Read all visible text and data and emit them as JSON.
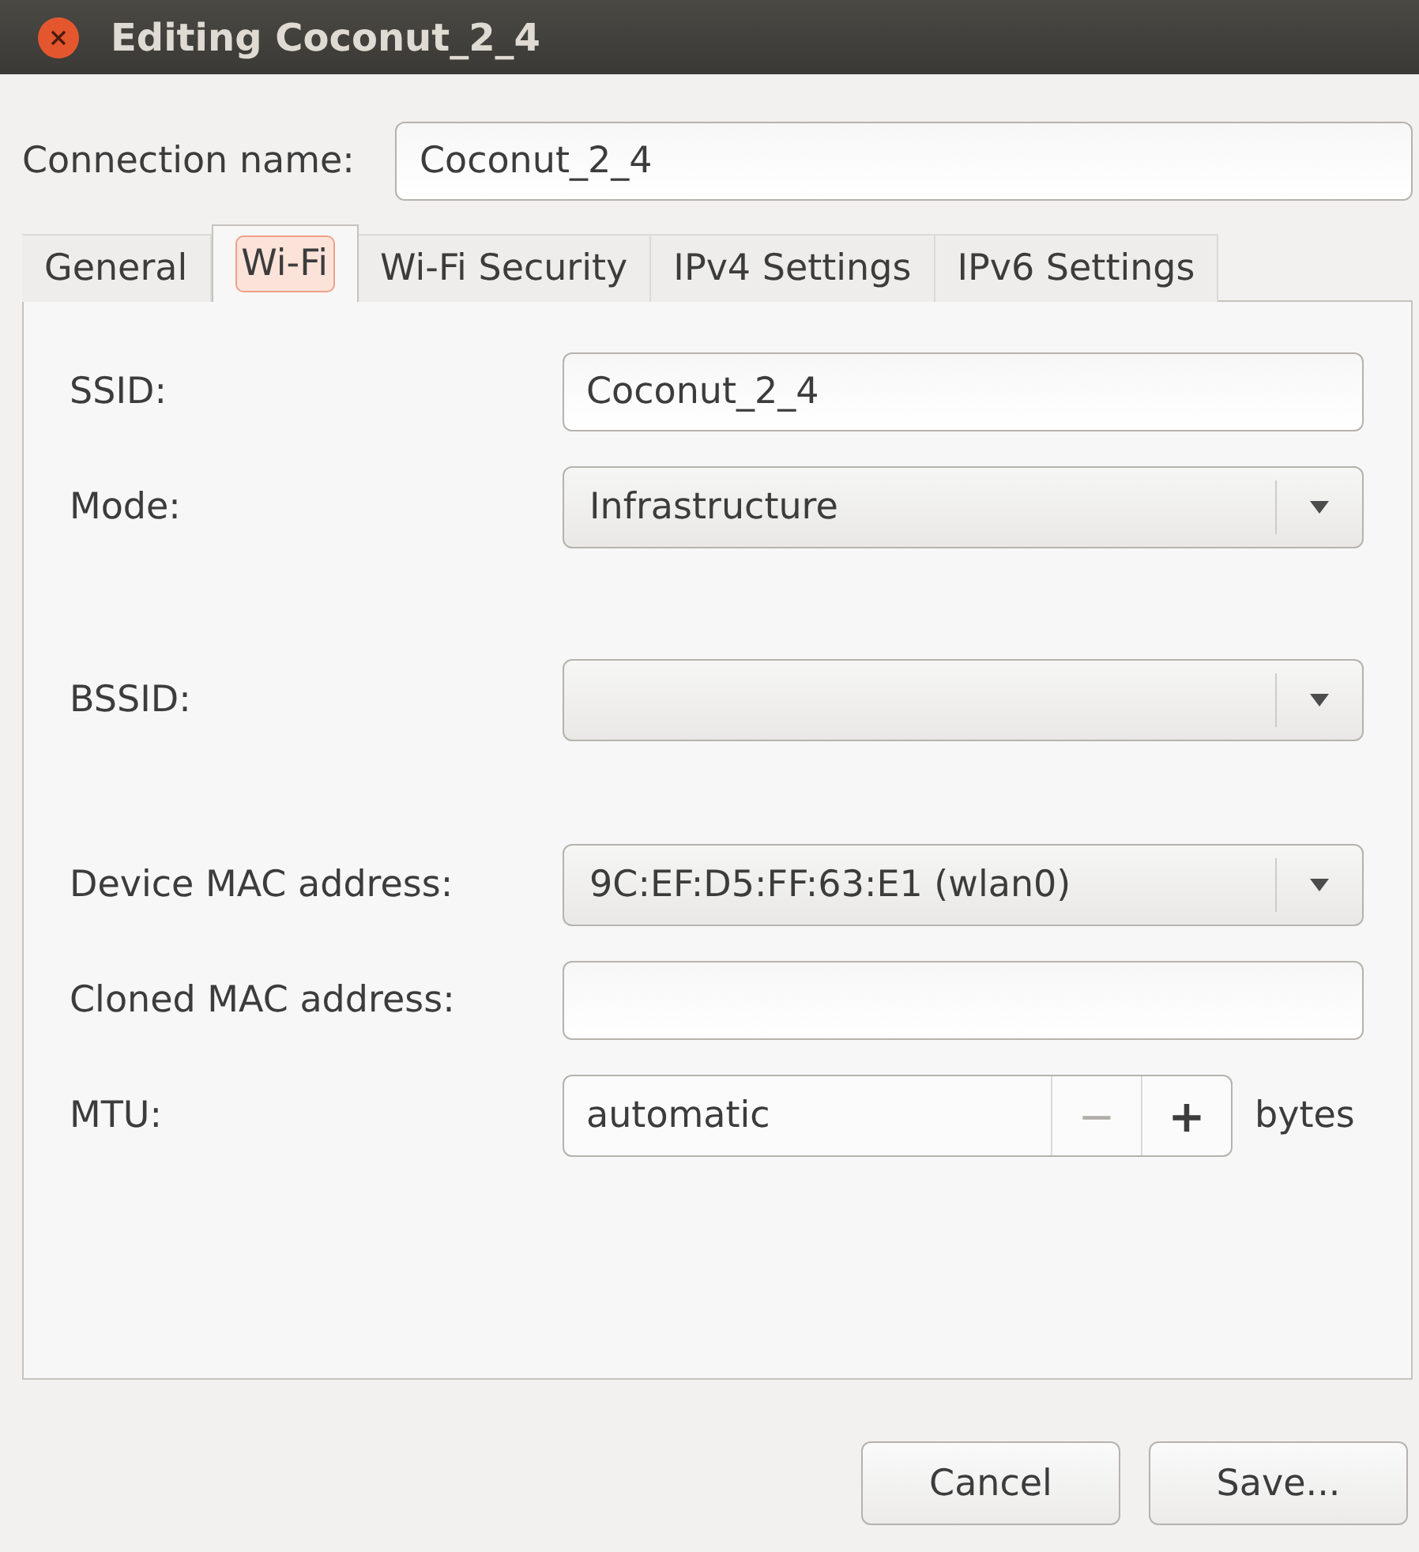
{
  "window": {
    "title": "Editing Coconut_2_4"
  },
  "connection_name": {
    "label": "Connection name:",
    "value": "Coconut_2_4"
  },
  "tabs": [
    {
      "label": "General",
      "selected": false
    },
    {
      "label": "Wi-Fi",
      "selected": true
    },
    {
      "label": "Wi-Fi Security",
      "selected": false
    },
    {
      "label": "IPv4 Settings",
      "selected": false
    },
    {
      "label": "IPv6 Settings",
      "selected": false
    }
  ],
  "fields": [
    {
      "kind": "entry",
      "label": "SSID:",
      "value": "Coconut_2_4"
    },
    {
      "kind": "combo",
      "label": "Mode:",
      "value": "Infrastructure"
    },
    {
      "kind": "combo",
      "label": "BSSID:"
    },
    {
      "kind": "combo",
      "label": "Device MAC address:",
      "value": "9C:EF:D5:FF:63:E1 (wlan0)"
    },
    {
      "kind": "entry",
      "label": "Cloned MAC address:"
    },
    {
      "kind": "spin",
      "label": "MTU:",
      "value": "automatic",
      "unit": "bytes",
      "decrement": {
        "label": "−",
        "disabled": true
      },
      "increment": {
        "label": "+",
        "disabled": false
      }
    }
  ],
  "buttons": [
    "Cancel",
    "Save..."
  ]
}
